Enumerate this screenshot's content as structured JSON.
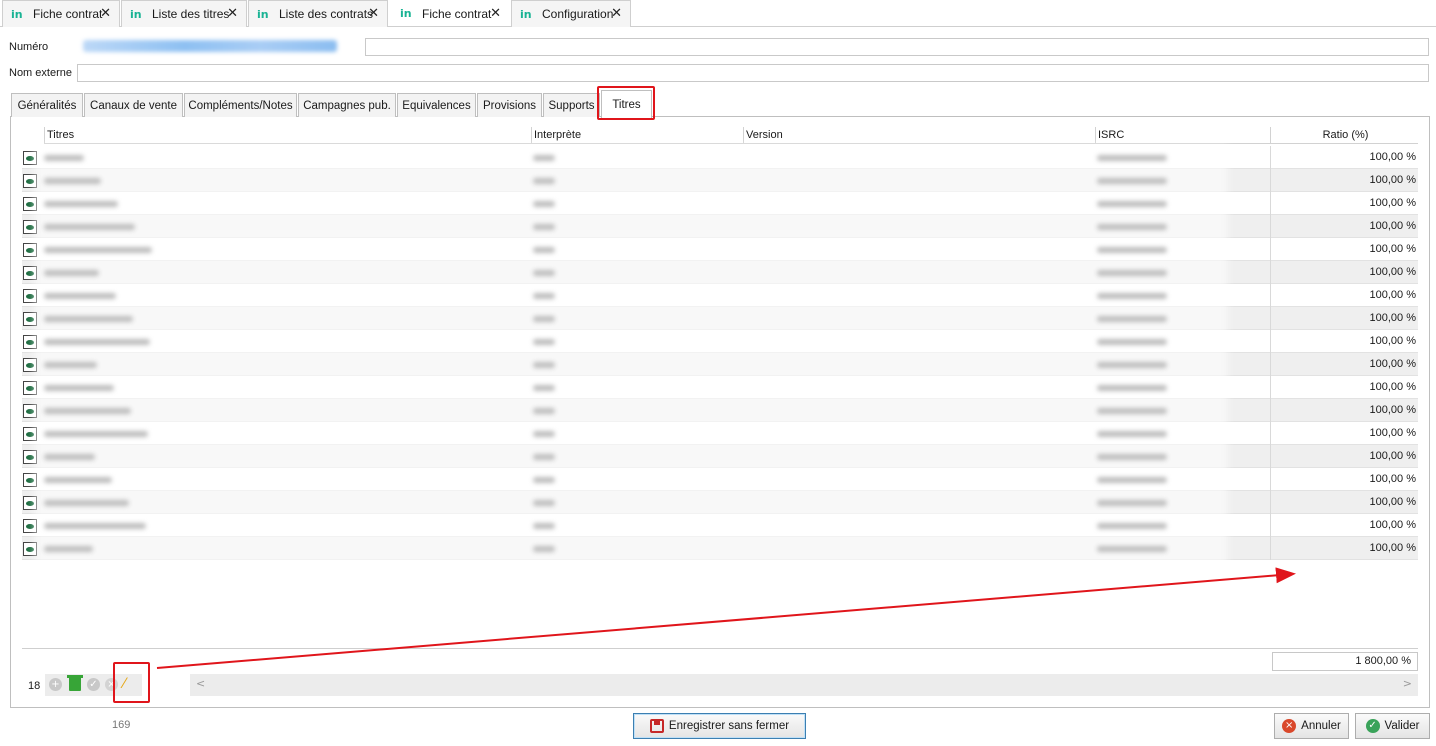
{
  "doc_tabs": [
    {
      "label": "Fiche contrat",
      "active": false
    },
    {
      "label": "Liste des titres",
      "active": false
    },
    {
      "label": "Liste des contrats",
      "active": false
    },
    {
      "label": "Fiche contrat",
      "active": true
    },
    {
      "label": "Configuration",
      "active": false
    }
  ],
  "tab_icon_text": "in",
  "close_glyph": "✕",
  "fields": {
    "numero_label": "Numéro",
    "nom_externe_label": "Nom externe",
    "nom_externe_value": ""
  },
  "content_tabs": [
    "Généralités",
    "Canaux de vente",
    "Compléments/Notes",
    "Campagnes pub.",
    "Equivalences",
    "Provisions",
    "Supports",
    "Titres"
  ],
  "active_content_tab": "Titres",
  "grid": {
    "columns": [
      "Titres",
      "Interprète",
      "Version",
      "ISRC",
      "Ratio (%)"
    ],
    "rows": [
      {
        "ratio": "100,00 %"
      },
      {
        "ratio": "100,00 %"
      },
      {
        "ratio": "100,00 %"
      },
      {
        "ratio": "100,00 %"
      },
      {
        "ratio": "100,00 %"
      },
      {
        "ratio": "100,00 %"
      },
      {
        "ratio": "100,00 %"
      },
      {
        "ratio": "100,00 %"
      },
      {
        "ratio": "100,00 %"
      },
      {
        "ratio": "100,00 %"
      },
      {
        "ratio": "100,00 %"
      },
      {
        "ratio": "100,00 %"
      },
      {
        "ratio": "100,00 %"
      },
      {
        "ratio": "100,00 %"
      },
      {
        "ratio": "100,00 %"
      },
      {
        "ratio": "100,00 %"
      },
      {
        "ratio": "100,00 %"
      },
      {
        "ratio": "100,00 %"
      }
    ],
    "total_ratio": "1 800,00 %",
    "row_count": "18"
  },
  "toolbar_icons": [
    "add-icon",
    "trash-icon",
    "check-icon",
    "cancel-icon",
    "magic-wand-icon"
  ],
  "scroll": {
    "left": "<",
    "right": ">"
  },
  "footer": {
    "record_number": "169",
    "save_label": "Enregistrer sans fermer",
    "cancel_label": "Annuler",
    "validate_label": "Valider"
  },
  "colors": {
    "brand_teal": "#19b394",
    "annotation_red": "#e0151b",
    "validate_green": "#3aa35a",
    "cancel_red": "#d9482b"
  }
}
